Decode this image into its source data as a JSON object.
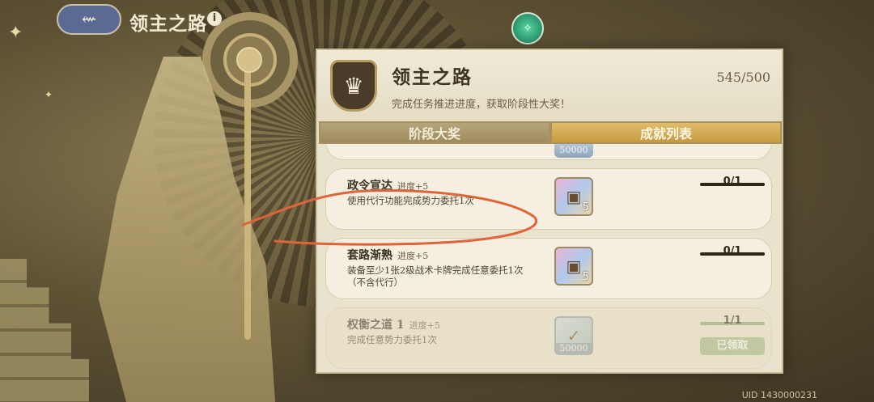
{
  "header": {
    "back_icon": "back-arrow-icon",
    "title": "领主之路",
    "info_icon": "i"
  },
  "compass_icon": "compass-icon",
  "panel": {
    "title": "领主之路",
    "subtitle": "完成任务推进进度，获取阶段性大奖！",
    "score": "545/500",
    "tabs": [
      {
        "label": "阶段大奖",
        "active": false
      },
      {
        "label": "成就列表",
        "active": true
      }
    ],
    "fragment_amount": "50000",
    "tasks": [
      {
        "name": "政令宣达",
        "progress_tag": "进度+5",
        "desc": "使用代行功能完成势力委托1次",
        "reward_count": "5",
        "progress": "0/1",
        "claimed": false
      },
      {
        "name": "套路渐熟",
        "progress_tag": "进度+5",
        "desc": "装备至少1张2级战术卡牌完成任意委托1次（不含代行）",
        "reward_count": "5",
        "progress": "0/1",
        "claimed": false
      },
      {
        "name": "权衡之道 1",
        "progress_tag": "进度+5",
        "desc": "完成任意势力委托1次",
        "reward_amount": "50000",
        "progress": "1/1",
        "claimed": true,
        "claimed_label": "已领取"
      }
    ]
  },
  "uid": "UID 1430000231",
  "colors": {
    "accent_tab": "#d4ab56",
    "panel_bg": "#e9e2cc",
    "annotation_stroke": "#e0643a"
  }
}
